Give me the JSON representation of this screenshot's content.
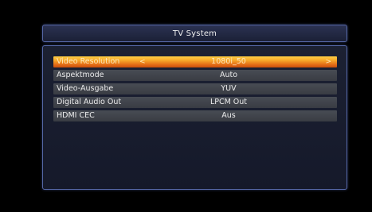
{
  "header": {
    "title": "TV System"
  },
  "settings": [
    {
      "label": "Video Resolution",
      "value": "1080i_50",
      "selected": true
    },
    {
      "label": "Aspektmode",
      "value": "Auto",
      "selected": false
    },
    {
      "label": "Video-Ausgabe",
      "value": "YUV",
      "selected": false
    },
    {
      "label": "Digital Audio Out",
      "value": "LPCM Out",
      "selected": false
    },
    {
      "label": "HDMI CEC",
      "value": "Aus",
      "selected": false
    }
  ],
  "icons": {
    "left_arrow": "<",
    "right_arrow": ">"
  },
  "colors": {
    "selection_top": "#ffcf45",
    "selection_bottom": "#c84f0d",
    "row_background": "#42464d",
    "frame_border": "#5668a8",
    "background": "#000000"
  }
}
